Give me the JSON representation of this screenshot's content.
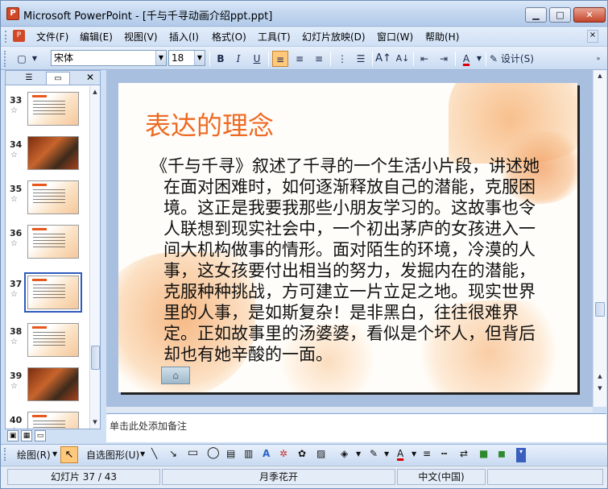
{
  "window": {
    "app_icon": "powerpoint-icon",
    "title": "Microsoft PowerPoint - [千与千寻动画介绍ppt.ppt]",
    "minimize_glyph": "▁",
    "maximize_glyph": "□",
    "close_glyph": "✕"
  },
  "menu": {
    "items": [
      "文件(F)",
      "编辑(E)",
      "视图(V)",
      "插入(I)",
      "格式(O)",
      "工具(T)",
      "幻灯片放映(D)",
      "窗口(W)",
      "帮助(H)"
    ]
  },
  "toolbar": {
    "font": "宋体",
    "size": "18",
    "bold": "B",
    "italic": "I",
    "underline": "U",
    "design_label": "设计(S)"
  },
  "slides_pane": {
    "thumbnails": [
      {
        "num": "33",
        "style": "light"
      },
      {
        "num": "34",
        "style": "dark"
      },
      {
        "num": "35",
        "style": "light"
      },
      {
        "num": "36",
        "style": "light"
      },
      {
        "num": "37",
        "style": "light",
        "selected": true
      },
      {
        "num": "38",
        "style": "light"
      },
      {
        "num": "39",
        "style": "dark"
      },
      {
        "num": "40",
        "style": "light"
      }
    ]
  },
  "slide": {
    "title": "表达的理念",
    "body": "《千与千寻》叙述了千寻的一个生活小片段，讲述她在面对困难时，如何逐渐释放自己的潜能，克服困境。这正是我要我那些小朋友学习的。这故事也令人联想到现实社会中，一个初出茅庐的女孩进入一间大机构做事的情形。面对陌生的环境，冷漠的人事，这女孩要付出相当的努力，发掘内在的潜能，克服种种挑战，方可建立一片立足之地。现实世界里的人事，是如斯复杂！是非黑白，往往很难界定。正如故事里的汤婆婆，看似是个坏人，但背后却也有她辛酸的一面。",
    "accent_color": "#ee6a24"
  },
  "notes": {
    "placeholder": "单击此处添加备注"
  },
  "drawing_toolbar": {
    "draw_label": "绘图(R)",
    "autoshapes_label": "自选图形(U)"
  },
  "status": {
    "slide_info": "幻灯片 37 / 43",
    "design": "月季花开",
    "language": "中文(中国)"
  }
}
